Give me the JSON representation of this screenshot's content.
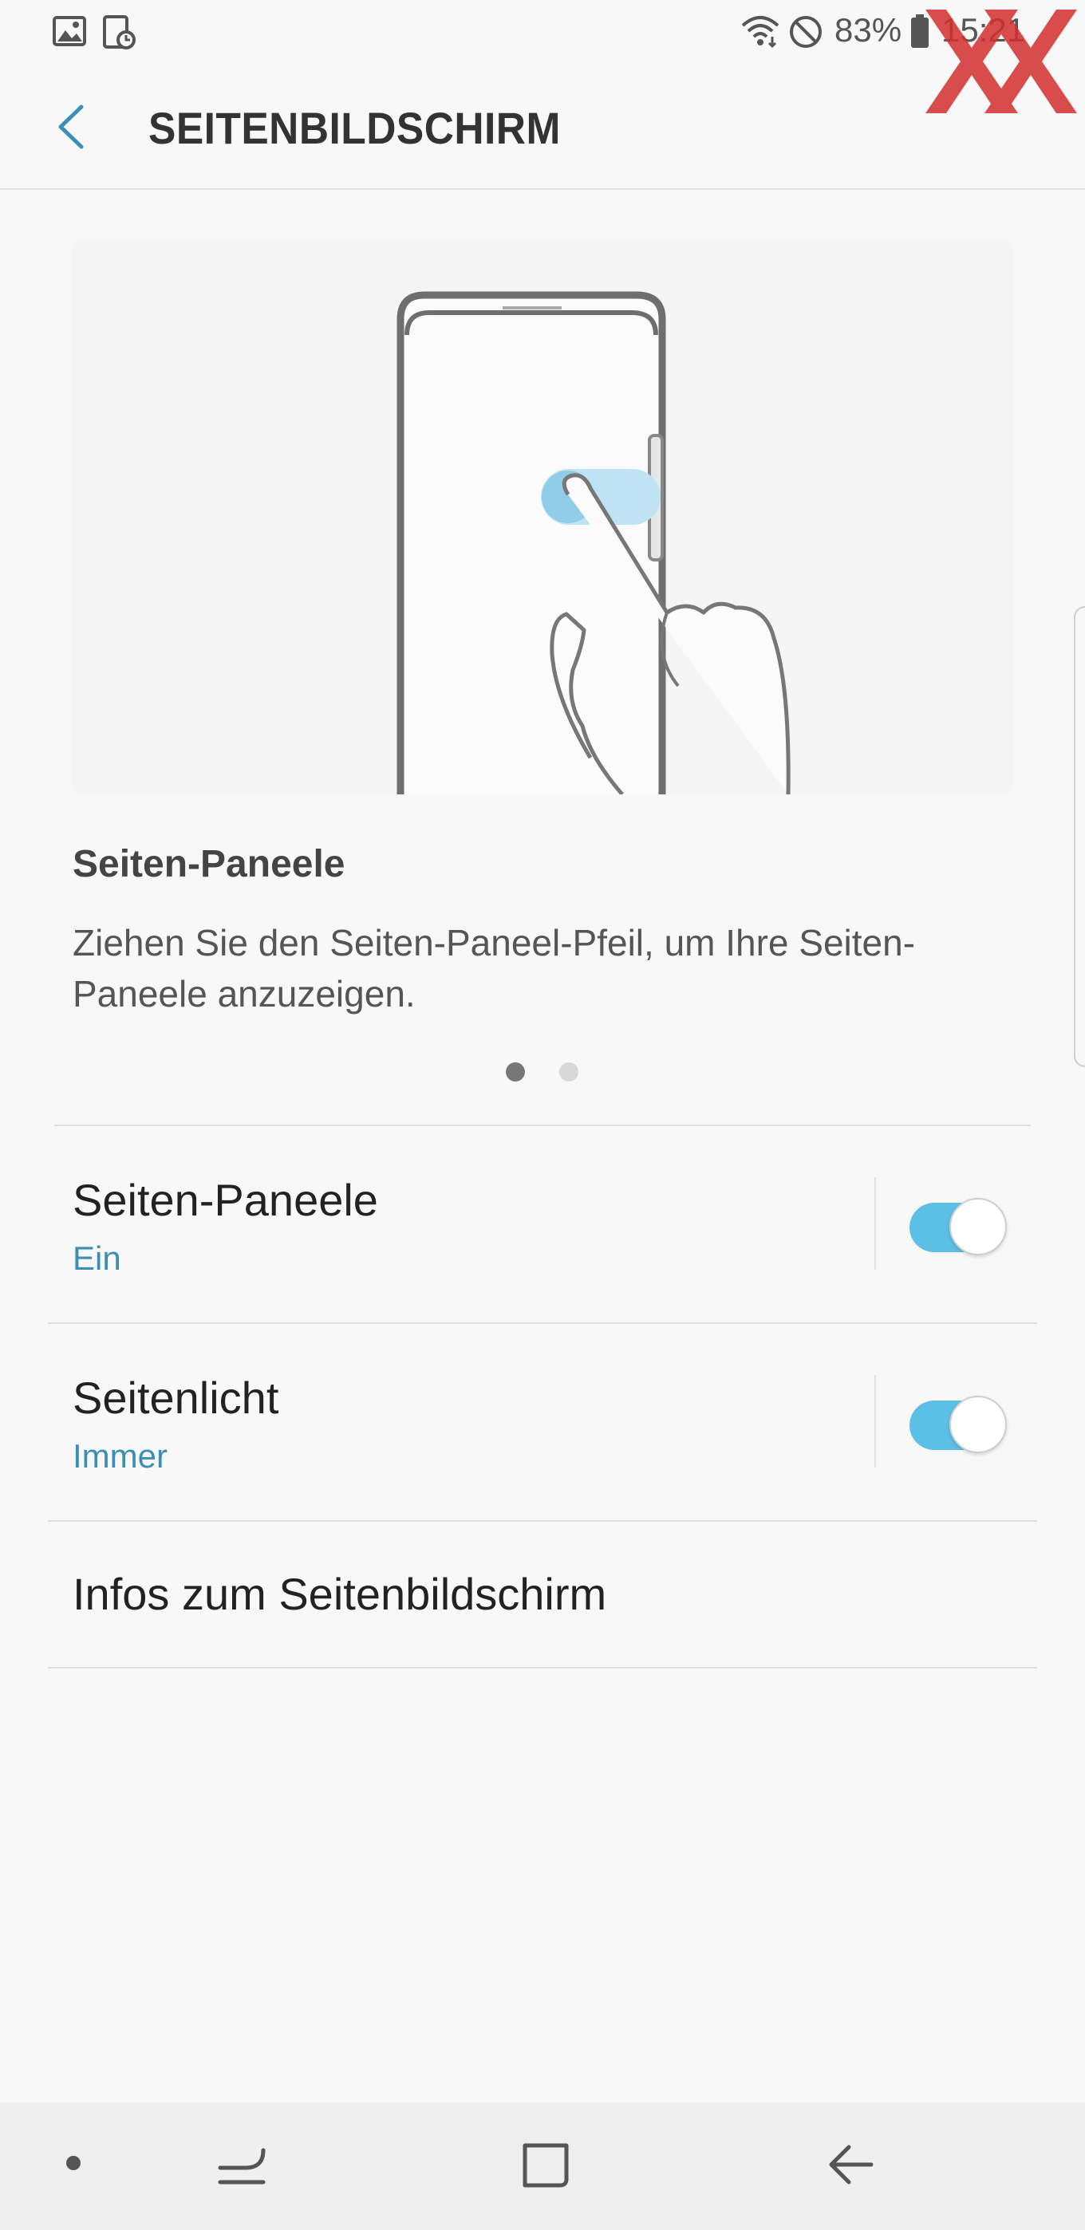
{
  "status_bar": {
    "battery_percent": "83%",
    "time": "15:21",
    "icons": [
      "gallery-icon",
      "screenshot-icon",
      "wifi-icon",
      "do-not-disturb-icon",
      "battery-icon"
    ],
    "watermark_text": "XX"
  },
  "app_bar": {
    "title": "SEITENBILDSCHIRM",
    "back_icon": "chevron-left-icon"
  },
  "intro_card": {
    "heading": "Seiten-Paneele",
    "description": "Ziehen Sie den Seiten-Paneel-Pfeil, um Ihre Seiten-Paneele anzuzeigen.",
    "page_index": 1,
    "page_count": 2
  },
  "settings": [
    {
      "title": "Seiten-Paneele",
      "subtitle": "Ein",
      "toggle_on": true
    },
    {
      "title": "Seitenlicht",
      "subtitle": "Immer",
      "toggle_on": true
    },
    {
      "title": "Infos zum Seitenbildschirm"
    }
  ],
  "colors": {
    "accent": "#3b8fb5",
    "toggle_on": "#5bbfe6",
    "watermark": "#d32f2f"
  },
  "nav_bar": {
    "icons": [
      "dot-icon",
      "recent-apps-icon",
      "home-icon",
      "back-arrow-icon"
    ]
  }
}
